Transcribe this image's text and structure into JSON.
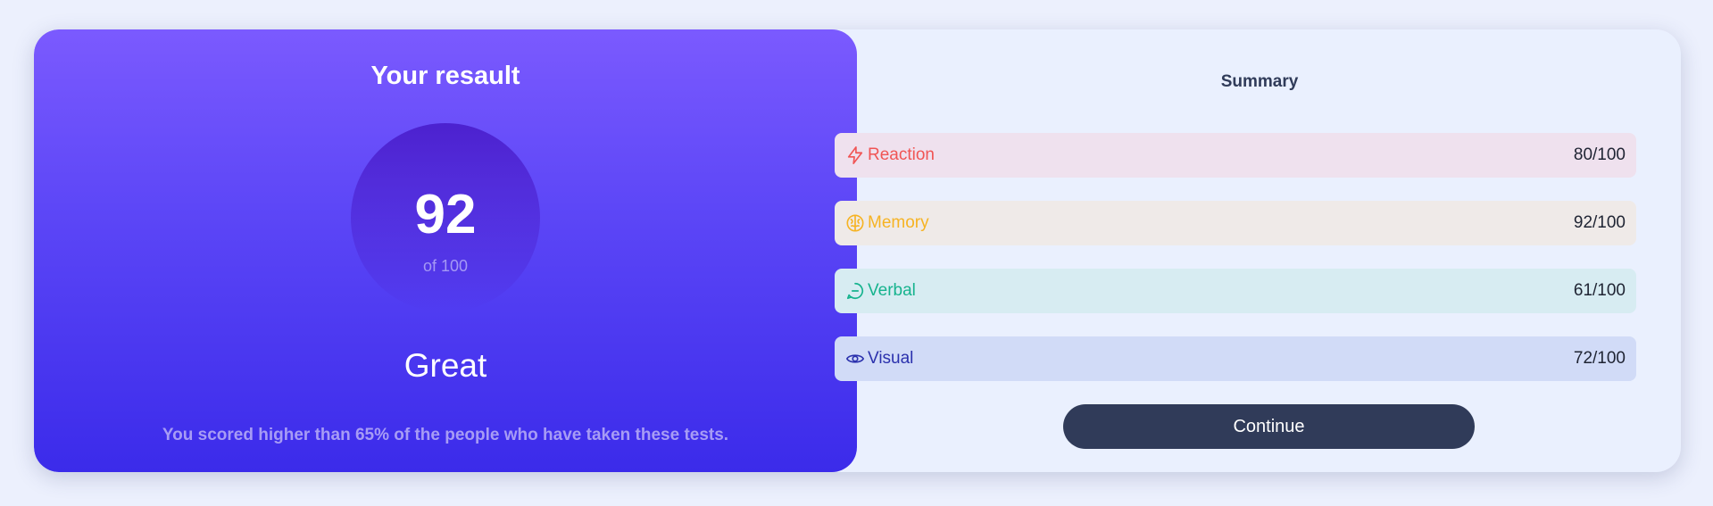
{
  "result": {
    "title": "Your resault",
    "score": "92",
    "of_label": "of 100",
    "rating": "Great",
    "description": "You scored higher than 65% of the people who have taken these tests."
  },
  "summary": {
    "title": "Summary",
    "items": [
      {
        "label": "Reaction",
        "score": "80/100",
        "icon": "lightning-icon",
        "color": "#f05555"
      },
      {
        "label": "Memory",
        "score": "92/100",
        "icon": "brain-icon",
        "color": "#f6b323"
      },
      {
        "label": "Verbal",
        "score": "61/100",
        "icon": "chat-bubble-icon",
        "color": "#16b38e"
      },
      {
        "label": "Visual",
        "score": "72/100",
        "icon": "eye-icon",
        "color": "#2b31ad"
      }
    ],
    "continue_label": "Continue"
  }
}
